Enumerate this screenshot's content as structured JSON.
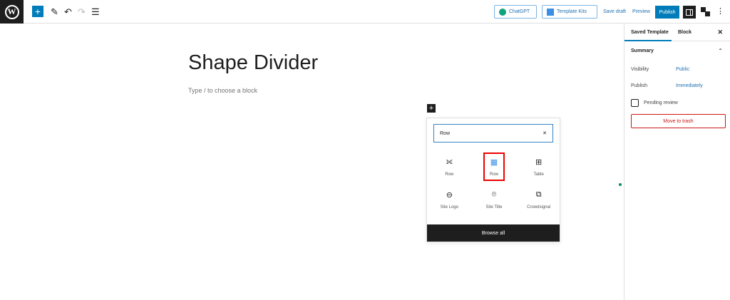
{
  "toolbar": {
    "logo": "W",
    "add": "+",
    "edit_icon": "✎",
    "undo": "↶",
    "redo": "↷",
    "list_view": "☰",
    "chatgpt": "ChatGPT",
    "template_kits": "Template Kits",
    "save_draft": "Save draft",
    "preview": "Preview",
    "publish": "Publish",
    "more": "⋮"
  },
  "editor": {
    "title": "Shape Divider",
    "placeholder": "Type / to choose a block",
    "add_block": "+"
  },
  "inserter": {
    "search_value": "Row",
    "clear": "✕",
    "blocks": [
      {
        "label": "Row",
        "icon": "⟗"
      },
      {
        "label": "Row",
        "icon": "▦"
      },
      {
        "label": "Table",
        "icon": "⊞"
      },
      {
        "label": "Site Logo",
        "icon": "⊖"
      },
      {
        "label": "Site Title",
        "icon": "⌾"
      },
      {
        "label": "Crowdsignal",
        "icon": "⧉"
      }
    ],
    "browse_all": "Browse all"
  },
  "sidebar": {
    "tabs": [
      "Saved Template",
      "Block"
    ],
    "close": "✕",
    "summary": "Summary",
    "chevron": "⌃",
    "visibility_label": "Visibility",
    "visibility_value": "Public",
    "publish_label": "Publish",
    "publish_value": "Immediately",
    "pending": "Pending review",
    "trash": "Move to trash"
  }
}
